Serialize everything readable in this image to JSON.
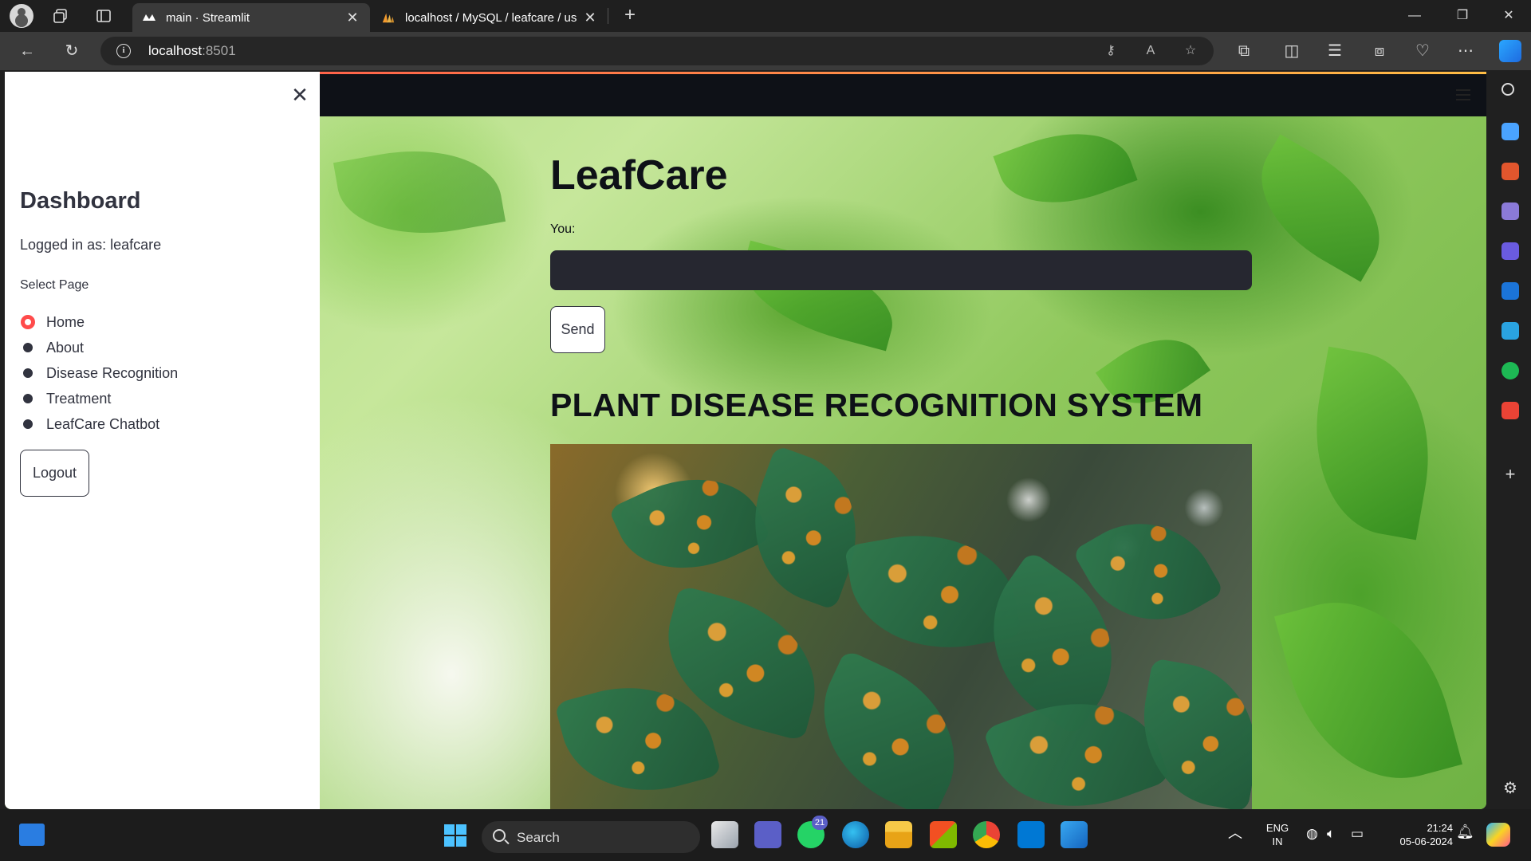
{
  "browser": {
    "tabs": [
      {
        "title": "main · Streamlit",
        "active": true
      },
      {
        "title": "localhost / MySQL / leafcare / us",
        "active": false
      }
    ],
    "url_host": "localhost",
    "url_port": ":8501"
  },
  "sidebar": {
    "title": "Dashboard",
    "logged_in": "Logged in as: leafcare",
    "select_label": "Select Page",
    "pages": [
      "Home",
      "About",
      "Disease Recognition",
      "Treatment",
      "LeafCare Chatbot"
    ],
    "selected_page": "Home",
    "logout_label": "Logout"
  },
  "main": {
    "title": "LeafCare",
    "input_label": "You:",
    "input_value": "",
    "send_label": "Send",
    "section_title": "PLANT DISEASE RECOGNITION SYSTEM"
  },
  "taskbar": {
    "search_placeholder": "Search",
    "whatsapp_badge": "21",
    "lang_line1": "ENG",
    "lang_line2": "IN",
    "time": "21:24",
    "date": "05-06-2024"
  },
  "colors": {
    "streamlit_accent": "#ff4b4b",
    "header_bg": "#0e1117",
    "input_bg": "#262730"
  }
}
